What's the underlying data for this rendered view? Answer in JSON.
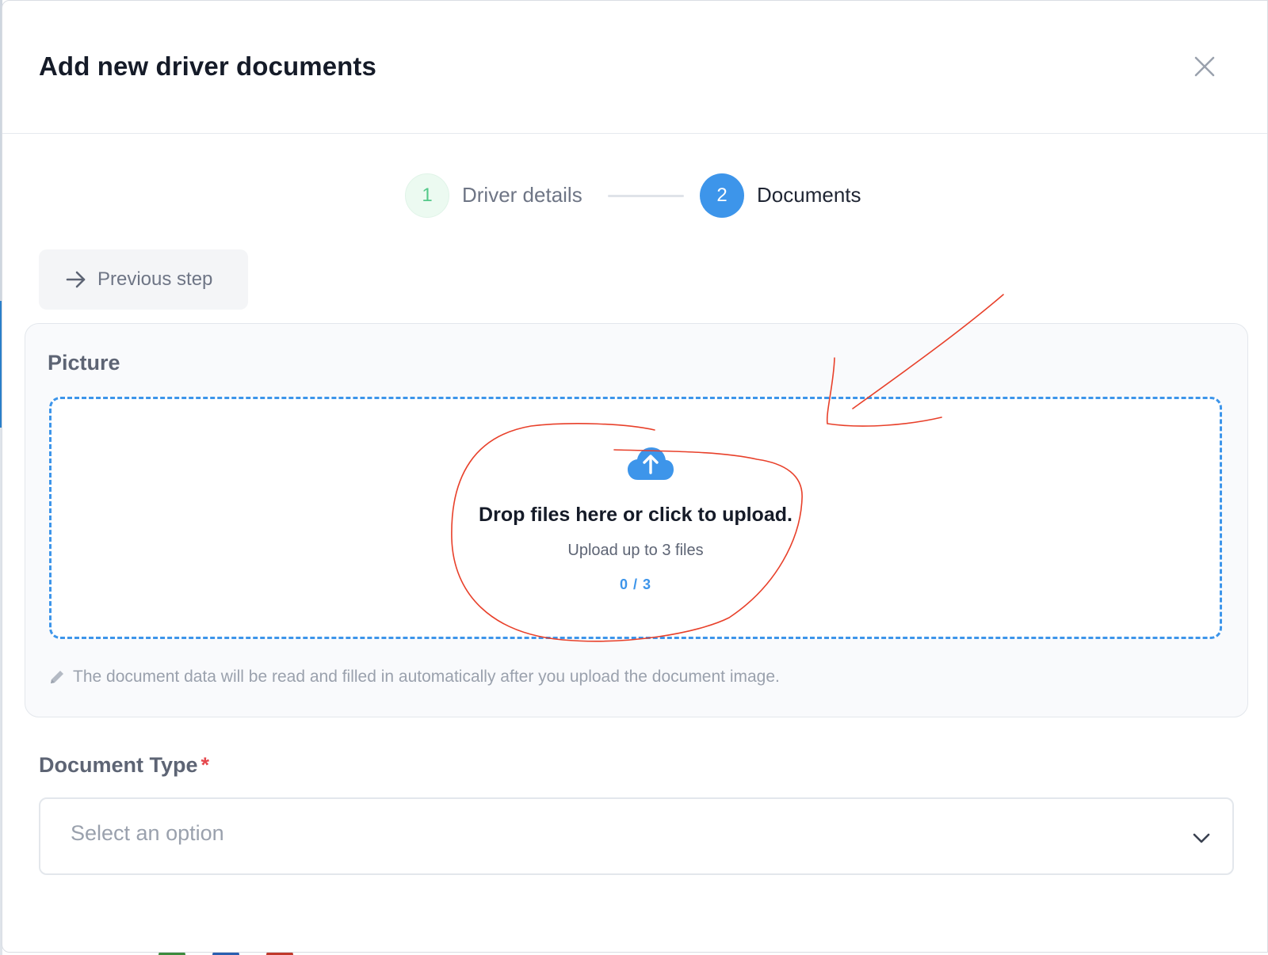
{
  "modal": {
    "title": "Add new driver documents",
    "close_icon": "close-icon"
  },
  "stepper": {
    "steps": [
      {
        "number": "1",
        "label": "Driver details",
        "status": "completed"
      },
      {
        "number": "2",
        "label": "Documents",
        "status": "active"
      }
    ]
  },
  "previous_step": {
    "label": "Previous step",
    "icon": "arrow-right-icon"
  },
  "picture": {
    "label": "Picture",
    "dropzone": {
      "icon": "cloud-upload-icon",
      "title": "Drop files here or click to upload.",
      "subtitle": "Upload up to 3 files",
      "count": "0 / 3"
    },
    "hint": {
      "icon": "pencil-icon",
      "text": "The document data will be read and filled in automatically after you upload the document image."
    }
  },
  "document_type": {
    "label": "Document Type",
    "required_marker": "*",
    "placeholder": "Select an option",
    "icon": "chevron-down-icon"
  },
  "colors": {
    "accent": "#3d95ea",
    "step_complete_text": "#55c98a",
    "step_complete_bg": "#ecfaf1",
    "required": "#e5484d",
    "annotation": "#e8402a"
  }
}
